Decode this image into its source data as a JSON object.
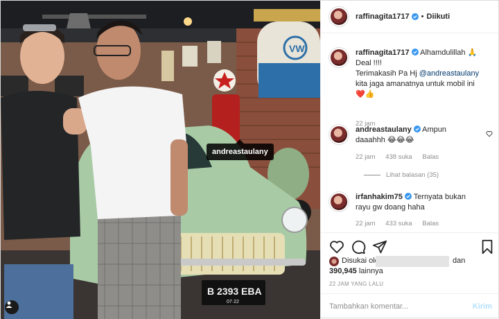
{
  "photo": {
    "tag_label": "andreastaulany",
    "plate_number": "B 2393 EBA",
    "plate_sub": "07·22"
  },
  "header": {
    "username": "raffinagita1717",
    "separator": "•",
    "follow_state": "Diikuti"
  },
  "caption": {
    "username": "raffinagita1717",
    "line1": "Alhamdulillah 🙏",
    "line2": "Deal !!!!",
    "line3_prefix": "Terimakasih Pa Hj ",
    "mention": "@andreastaulany",
    "line4": "kita jaga amanatnya untuk mobil ini",
    "line5": "❤️👍",
    "time": "22 jam"
  },
  "comments": [
    {
      "username": "andreastaulany",
      "text_line1": "Ampun",
      "text_line2": "daaahhh 😂😂😂",
      "time": "22 jam",
      "likes": "438 suka",
      "reply": "Balas",
      "view_replies": "Lihat balasan (35)"
    },
    {
      "username": "irfanhakim75",
      "text_line1": "Ternyata bukan",
      "text_line2": "rayu gw doang haha",
      "time": "22 jam",
      "likes": "433 suka",
      "reply": "Balas"
    }
  ],
  "likes": {
    "prefix": "Disukai oleh",
    "and": "dan",
    "count": "390,945",
    "suffix": "lainnya"
  },
  "timestamp": "22 JAM YANG LALU",
  "add_comment": {
    "placeholder": "Tambahkan komentar...",
    "send_label": "Kirim"
  },
  "colors": {
    "verified": "#3897f0",
    "link": "#00376b",
    "muted": "#8e8e8e",
    "send_disabled": "#b2dffc"
  },
  "icons": [
    "heart-icon",
    "comment-icon",
    "share-icon",
    "bookmark-icon",
    "verified-icon",
    "user-tag-icon"
  ]
}
